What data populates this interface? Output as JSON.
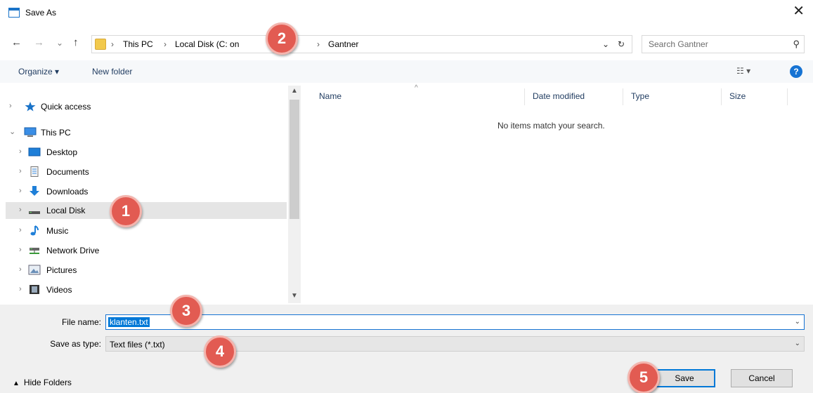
{
  "window": {
    "title": "Save As",
    "close_glyph": "✕"
  },
  "nav": {
    "back": "←",
    "forward": "→",
    "recent": "⌄",
    "up": "↑",
    "breadcrumbs": [
      "This PC",
      "Local Disk (C: on",
      "Gantner"
    ],
    "separator": "›",
    "dropdown": "⌄",
    "refresh": "↻",
    "search_placeholder": "Search Gantner"
  },
  "toolbar": {
    "organize": "Organize ▾",
    "new_folder": "New folder",
    "view": "☷ ▾",
    "help": "?"
  },
  "sidebar": {
    "items": [
      {
        "label": "Quick access",
        "icon": "star-icon",
        "expanded": false
      },
      {
        "label": "This PC",
        "icon": "computer-icon",
        "expanded": true
      },
      {
        "label": "Desktop",
        "icon": "desktop-icon"
      },
      {
        "label": "Documents",
        "icon": "documents-icon"
      },
      {
        "label": "Downloads",
        "icon": "download-icon"
      },
      {
        "label": "Local Disk",
        "icon": "drive-icon",
        "selected": true
      },
      {
        "label": "Music",
        "icon": "music-icon"
      },
      {
        "label": "Network Drive",
        "icon": "network-drive-icon"
      },
      {
        "label": "Pictures",
        "icon": "pictures-icon"
      },
      {
        "label": "Videos",
        "icon": "videos-icon"
      }
    ]
  },
  "file_list": {
    "columns": [
      "Name",
      "Date modified",
      "Type",
      "Size"
    ],
    "empty_message": "No items match your search."
  },
  "form": {
    "file_name_label": "File name:",
    "file_name_value": "klanten.txt",
    "save_type_label": "Save as type:",
    "save_type_value": "Text files (*.txt)",
    "hide_folders": "Hide Folders",
    "save_button": "Save",
    "cancel_button": "Cancel"
  },
  "badges": [
    "1",
    "2",
    "3",
    "4",
    "5"
  ],
  "colors": {
    "accent": "#0078d7",
    "badge": "#e25b52",
    "help": "#1673d3"
  }
}
